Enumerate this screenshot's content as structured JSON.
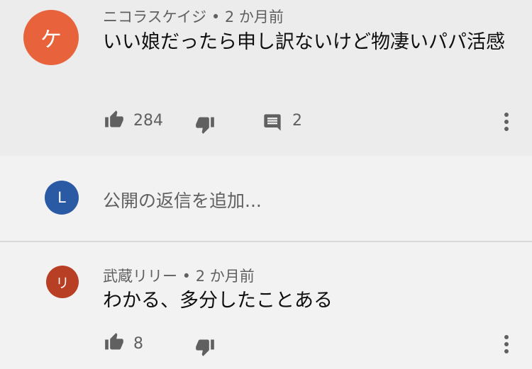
{
  "comments": [
    {
      "avatar_letter": "ケ",
      "avatar_color": "#e8623c",
      "meta": "ニコラスケイジ • 2 か月前",
      "text": "いい娘だったら申し訳ないけど物凄いパパ活感",
      "likes": "284",
      "replies": "2"
    },
    {
      "avatar_letter": "リ",
      "avatar_color": "#b83f24",
      "meta": "武蔵リリー • 2 か月前",
      "text": "わかる、多分したことある",
      "likes": "8"
    }
  ],
  "reply": {
    "avatar_letter": "L",
    "avatar_color": "#2b5aa5",
    "placeholder": "公開の返信を追加..."
  },
  "icons": [
    "thumb-up-icon",
    "thumb-down-icon",
    "comment-icon",
    "more-vert-icon"
  ]
}
